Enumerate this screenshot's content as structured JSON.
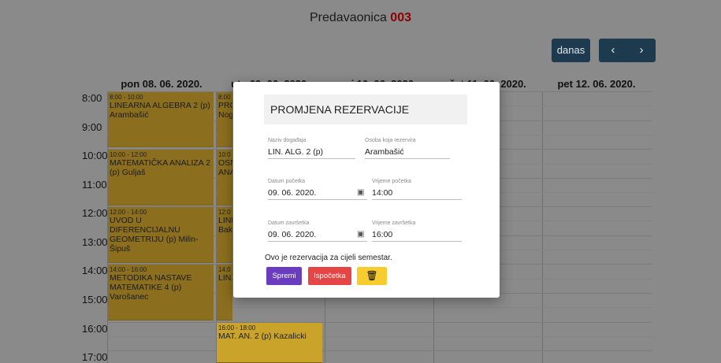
{
  "header": {
    "title_prefix": "Predavaonica",
    "room_number": "003"
  },
  "navigation": {
    "today_label": "danas",
    "prev_icon": "chevron-left-icon",
    "next_icon": "chevron-right-icon",
    "prev_glyph": "‹",
    "next_glyph": "›"
  },
  "calendar": {
    "days": [
      "pon 08. 06. 2020.",
      "uto 09. 06. 2020.",
      "sri 10. 06. 2020.",
      "čet 11. 06. 2020.",
      "pet 12. 06. 2020."
    ],
    "hours": [
      "8:00",
      "9:00",
      "10:00",
      "11:00",
      "12:00",
      "13:00",
      "14:00",
      "15:00",
      "16:00",
      "17:00"
    ],
    "events": [
      {
        "time": "8:00 - 10:00",
        "title": "LINEARNA ALGEBRA 2 (p) Arambašić"
      },
      {
        "time": "10:00 - 12:00",
        "title": "MATEMATIČKA ANALIZA 2 (p) Guljaš"
      },
      {
        "time": "12:00 - 14:00",
        "title": "UVOD U DIFERENCIJALNU GEOMETRIJU (p) Milin-Šipuš"
      },
      {
        "time": "14:00 - 16:00",
        "title": "METODIKA NASTAVE MATEMATIKE 4 (p) Varošanec"
      },
      {
        "time": "8:00",
        "title": "PRO Nog"
      },
      {
        "time": "10:0",
        "title": "OSN ANA"
      },
      {
        "time": "12:0",
        "title": "LINE Bak"
      },
      {
        "time": "14:0",
        "title": "LIN."
      },
      {
        "time": "16:00 - 18:00",
        "title": "MAT. AN. 2 (p) Kazalicki"
      }
    ]
  },
  "modal": {
    "title": "PROMJENA REZERVACIJE",
    "event_name_label": "Naziv događaja",
    "event_name_value": "LIN. ALG. 2 (p)",
    "person_label": "Osoba koja rezervira",
    "person_value": "Arambašić",
    "start_date_label": "Datum početka",
    "start_date_value": "09. 06. 2020.",
    "start_time_label": "Vrijeme početka",
    "start_time_value": "14:00",
    "end_date_label": "Datum završetka",
    "end_date_value": "09. 06. 2020.",
    "end_time_label": "Vrijeme završetka",
    "end_time_value": "16:00",
    "semester_note": "Ovo je rezervacija za cijeli semestar.",
    "save_label": "Spremi",
    "reset_label": "Ispočetka",
    "delete_icon": "trash-icon",
    "delete_glyph": "🗑",
    "calendar_icon_glyph": "▣"
  },
  "colors": {
    "event": "#caa32a",
    "save": "#6a3cc0",
    "reset": "#e64545",
    "delete": "#f7cc2f",
    "nav": "#1d3a4f",
    "room_number": "#8b0000"
  }
}
